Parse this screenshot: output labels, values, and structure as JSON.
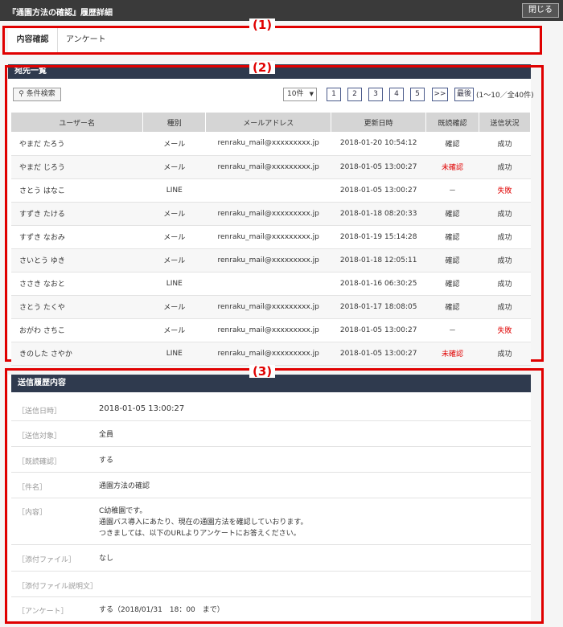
{
  "window": {
    "title": "『通園方法の確認』履歴詳細",
    "close_label": "閉じる"
  },
  "markers": [
    "(1)",
    "(2)",
    "(3)"
  ],
  "tabs": [
    {
      "label": "内容確認",
      "active": true
    },
    {
      "label": "アンケート",
      "active": false
    }
  ],
  "recipients": {
    "heading": "宛先一覧",
    "search_label": "条件検索",
    "per_page": "10件",
    "pages": [
      "1",
      "2",
      "3",
      "4",
      "5",
      ">>",
      "最後"
    ],
    "page_info": "(1〜10／全40件)",
    "columns": [
      "ユーザー名",
      "種別",
      "メールアドレス",
      "更新日時",
      "既読確認",
      "送信状況"
    ],
    "rows": [
      {
        "name": "やまだ たろう",
        "type": "メール",
        "email": "renraku_mail@xxxxxxxxx.jp",
        "updated": "2018-01-20 10:54:12",
        "read": "確認",
        "status": "成功"
      },
      {
        "name": "やまだ じろう",
        "type": "メール",
        "email": "renraku_mail@xxxxxxxxx.jp",
        "updated": "2018-01-05 13:00:27",
        "read": "未確認",
        "status": "成功"
      },
      {
        "name": "さとう はなこ",
        "type": "LINE",
        "email": "",
        "updated": "2018-01-05 13:00:27",
        "read": "－",
        "status": "失敗"
      },
      {
        "name": "すずき たける",
        "type": "メール",
        "email": "renraku_mail@xxxxxxxxx.jp",
        "updated": "2018-01-18 08:20:33",
        "read": "確認",
        "status": "成功"
      },
      {
        "name": "すずき なおみ",
        "type": "メール",
        "email": "renraku_mail@xxxxxxxxx.jp",
        "updated": "2018-01-19 15:14:28",
        "read": "確認",
        "status": "成功"
      },
      {
        "name": "さいとう ゆき",
        "type": "メール",
        "email": "renraku_mail@xxxxxxxxx.jp",
        "updated": "2018-01-18 12:05:11",
        "read": "確認",
        "status": "成功"
      },
      {
        "name": "ささき なおと",
        "type": "LINE",
        "email": "",
        "updated": "2018-01-16 06:30:25",
        "read": "確認",
        "status": "成功"
      },
      {
        "name": "さとう たくや",
        "type": "メール",
        "email": "renraku_mail@xxxxxxxxx.jp",
        "updated": "2018-01-17 18:08:05",
        "read": "確認",
        "status": "成功"
      },
      {
        "name": "おがわ さちこ",
        "type": "メール",
        "email": "renraku_mail@xxxxxxxxx.jp",
        "updated": "2018-01-05 13:00:27",
        "read": "－",
        "status": "失敗"
      },
      {
        "name": "きのした さやか",
        "type": "LINE",
        "email": "renraku_mail@xxxxxxxxx.jp",
        "updated": "2018-01-05 13:00:27",
        "read": "未確認",
        "status": "成功"
      }
    ]
  },
  "history": {
    "heading": "送信履歴内容",
    "rows": [
      {
        "label": "［送信日時］",
        "value": "2018-01-05 13:00:27"
      },
      {
        "label": "［送信対象］",
        "value": "全員"
      },
      {
        "label": "［既読確認］",
        "value": "する"
      },
      {
        "label": "［件名］",
        "value": "通園方法の確認"
      },
      {
        "label": "［内容］",
        "lines": [
          "C幼稚園です。",
          "通園バス導入にあたり、現在の通園方法を確認していおります。",
          "つきましては、以下のURLよりアンケートにお答えください。"
        ]
      },
      {
        "label": "［添付ファイル］",
        "value": "なし"
      },
      {
        "label": "［添付ファイル説明文］",
        "value": ""
      },
      {
        "label": "［アンケート］",
        "value": "する（2018/01/31　18：00　まで）"
      }
    ]
  },
  "colors": {
    "accent_red": "#e00000",
    "header_navy": "#2f3a4e",
    "titlebar": "#3a3a3a"
  }
}
